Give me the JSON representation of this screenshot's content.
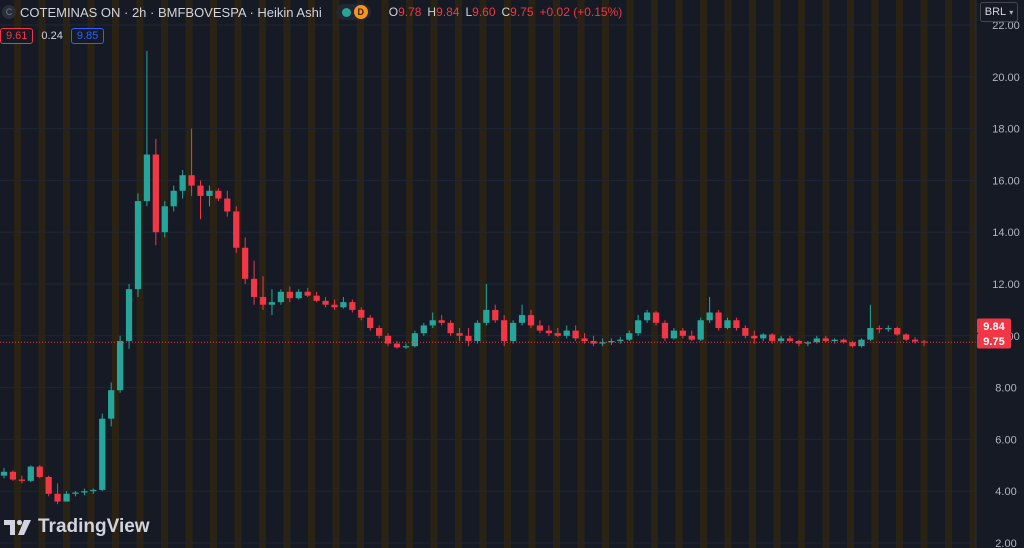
{
  "header": {
    "symbol_icon": "C",
    "title": "COTEMINAS ON · 2h · BMFBOVESPA · Heikin Ashi",
    "status_icon": "green-dot-icon",
    "data_badge": "D",
    "ohlc": [
      {
        "key": "O",
        "value": "9.78"
      },
      {
        "key": "H",
        "value": "9.84"
      },
      {
        "key": "L",
        "value": "9.60"
      },
      {
        "key": "C",
        "value": "9.75"
      },
      {
        "key": "",
        "value": "+0.02 (+0.15%)"
      }
    ]
  },
  "trade": {
    "sell": "9.61",
    "spread": "0.24",
    "buy": "9.85"
  },
  "currency": {
    "label": "BRL",
    "caret_icon": "chevron-down-icon"
  },
  "branding": {
    "name": "TradingView"
  },
  "colors": {
    "up": "#26a69a",
    "down": "#f23645",
    "background": "#161a25",
    "session": "#2a2314"
  },
  "chart_data": {
    "type": "candlestick",
    "yticks": [
      "22.00",
      "20.00",
      "18.00",
      "16.00",
      "14.00",
      "12.00",
      "10.00",
      "8.00",
      "6.00",
      "4.00",
      "2.00"
    ],
    "ylim": [
      2,
      22
    ],
    "price_labels": [
      {
        "label": "9.84",
        "value": 9.84
      },
      {
        "label": "9.75",
        "value": 9.75
      }
    ],
    "candles": [
      [
        4.6,
        4.9,
        4.5,
        4.75
      ],
      [
        4.75,
        4.8,
        4.4,
        4.45
      ],
      [
        4.45,
        4.6,
        4.3,
        4.4
      ],
      [
        4.4,
        5.0,
        4.35,
        4.95
      ],
      [
        4.95,
        5.0,
        4.5,
        4.55
      ],
      [
        4.55,
        4.6,
        3.8,
        3.9
      ],
      [
        3.9,
        4.3,
        3.5,
        3.6
      ],
      [
        3.6,
        4.0,
        3.6,
        3.9
      ],
      [
        3.9,
        4.0,
        3.8,
        3.95
      ],
      [
        3.95,
        4.1,
        3.85,
        4.0
      ],
      [
        4.0,
        4.1,
        3.9,
        4.05
      ],
      [
        4.05,
        7.0,
        4.0,
        6.8
      ],
      [
        6.8,
        8.2,
        6.5,
        7.9
      ],
      [
        7.9,
        10.0,
        7.8,
        9.8
      ],
      [
        9.8,
        12.0,
        9.5,
        11.8
      ],
      [
        11.8,
        15.5,
        11.5,
        15.2
      ],
      [
        15.2,
        21.0,
        15.0,
        17.0
      ],
      [
        17.0,
        17.6,
        13.5,
        14.0
      ],
      [
        14.0,
        15.2,
        13.8,
        15.0
      ],
      [
        15.0,
        15.8,
        14.8,
        15.6
      ],
      [
        15.6,
        16.4,
        15.3,
        16.2
      ],
      [
        16.2,
        18.0,
        15.4,
        15.8
      ],
      [
        15.8,
        16.0,
        14.5,
        15.4
      ],
      [
        15.4,
        15.8,
        15.0,
        15.6
      ],
      [
        15.6,
        15.7,
        15.2,
        15.3
      ],
      [
        15.3,
        15.6,
        14.6,
        14.8
      ],
      [
        14.8,
        15.0,
        13.2,
        13.4
      ],
      [
        13.4,
        13.8,
        12.0,
        12.2
      ],
      [
        12.2,
        12.9,
        11.2,
        11.5
      ],
      [
        11.5,
        12.3,
        11.0,
        11.2
      ],
      [
        11.2,
        11.8,
        10.8,
        11.3
      ],
      [
        11.3,
        11.8,
        11.2,
        11.7
      ],
      [
        11.7,
        11.9,
        11.3,
        11.45
      ],
      [
        11.45,
        11.8,
        11.4,
        11.7
      ],
      [
        11.7,
        11.85,
        11.5,
        11.55
      ],
      [
        11.55,
        11.7,
        11.3,
        11.35
      ],
      [
        11.35,
        11.5,
        11.1,
        11.2
      ],
      [
        11.2,
        11.4,
        11.0,
        11.1
      ],
      [
        11.1,
        11.5,
        11.05,
        11.3
      ],
      [
        11.3,
        11.4,
        10.9,
        11.0
      ],
      [
        11.0,
        11.1,
        10.6,
        10.7
      ],
      [
        10.7,
        10.8,
        10.2,
        10.3
      ],
      [
        10.3,
        10.4,
        9.9,
        10.0
      ],
      [
        10.0,
        10.1,
        9.6,
        9.7
      ],
      [
        9.7,
        9.8,
        9.5,
        9.55
      ],
      [
        9.55,
        9.7,
        9.5,
        9.6
      ],
      [
        9.6,
        10.2,
        9.55,
        10.1
      ],
      [
        10.1,
        10.5,
        10.0,
        10.4
      ],
      [
        10.4,
        10.9,
        10.3,
        10.6
      ],
      [
        10.6,
        10.8,
        10.4,
        10.5
      ],
      [
        10.5,
        10.6,
        10.0,
        10.1
      ],
      [
        10.1,
        10.3,
        9.8,
        10.0
      ],
      [
        10.0,
        10.3,
        9.6,
        9.8
      ],
      [
        9.8,
        10.6,
        9.7,
        10.5
      ],
      [
        10.5,
        12.0,
        10.4,
        11.0
      ],
      [
        11.0,
        11.2,
        10.5,
        10.6
      ],
      [
        10.6,
        10.8,
        9.6,
        9.8
      ],
      [
        9.8,
        10.6,
        9.7,
        10.5
      ],
      [
        10.5,
        11.2,
        10.4,
        10.8
      ],
      [
        10.8,
        11.0,
        10.3,
        10.4
      ],
      [
        10.4,
        10.6,
        10.1,
        10.2
      ],
      [
        10.2,
        10.4,
        10.0,
        10.1
      ],
      [
        10.1,
        10.3,
        9.95,
        10.0
      ],
      [
        10.0,
        10.4,
        9.9,
        10.2
      ],
      [
        10.2,
        10.4,
        9.8,
        9.9
      ],
      [
        9.9,
        10.1,
        9.7,
        9.8
      ],
      [
        9.8,
        10.0,
        9.6,
        9.7
      ],
      [
        9.7,
        9.9,
        9.6,
        9.75
      ],
      [
        9.75,
        9.9,
        9.65,
        9.8
      ],
      [
        9.8,
        9.95,
        9.7,
        9.85
      ],
      [
        9.85,
        10.2,
        9.8,
        10.1
      ],
      [
        10.1,
        10.8,
        10.0,
        10.6
      ],
      [
        10.6,
        11.0,
        10.5,
        10.9
      ],
      [
        10.9,
        10.95,
        10.4,
        10.5
      ],
      [
        10.5,
        10.6,
        9.8,
        9.9
      ],
      [
        9.9,
        10.3,
        9.85,
        10.2
      ],
      [
        10.2,
        10.3,
        9.9,
        10.0
      ],
      [
        10.0,
        10.2,
        9.8,
        9.85
      ],
      [
        9.85,
        10.7,
        9.8,
        10.6
      ],
      [
        10.6,
        11.5,
        10.5,
        10.9
      ],
      [
        10.9,
        11.0,
        10.2,
        10.3
      ],
      [
        10.3,
        10.7,
        10.25,
        10.6
      ],
      [
        10.6,
        10.7,
        10.2,
        10.3
      ],
      [
        10.3,
        10.4,
        9.9,
        10.0
      ],
      [
        10.0,
        10.2,
        9.7,
        9.9
      ],
      [
        9.9,
        10.1,
        9.8,
        10.05
      ],
      [
        10.05,
        10.1,
        9.7,
        9.8
      ],
      [
        9.8,
        10.0,
        9.7,
        9.9
      ],
      [
        9.9,
        10.0,
        9.75,
        9.8
      ],
      [
        9.8,
        9.85,
        9.6,
        9.7
      ],
      [
        9.7,
        9.8,
        9.6,
        9.75
      ],
      [
        9.75,
        10.0,
        9.7,
        9.9
      ],
      [
        9.9,
        10.0,
        9.75,
        9.8
      ],
      [
        9.8,
        9.9,
        9.7,
        9.85
      ],
      [
        9.85,
        9.9,
        9.7,
        9.75
      ],
      [
        9.75,
        9.8,
        9.55,
        9.6
      ],
      [
        9.6,
        9.9,
        9.55,
        9.85
      ],
      [
        9.85,
        11.2,
        9.8,
        10.3
      ],
      [
        10.3,
        10.4,
        10.1,
        10.25
      ],
      [
        10.25,
        10.4,
        10.15,
        10.3
      ],
      [
        10.3,
        10.35,
        10.0,
        10.05
      ],
      [
        10.05,
        10.1,
        9.8,
        9.85
      ],
      [
        9.85,
        9.95,
        9.7,
        9.78
      ],
      [
        9.78,
        9.84,
        9.6,
        9.75
      ]
    ]
  }
}
